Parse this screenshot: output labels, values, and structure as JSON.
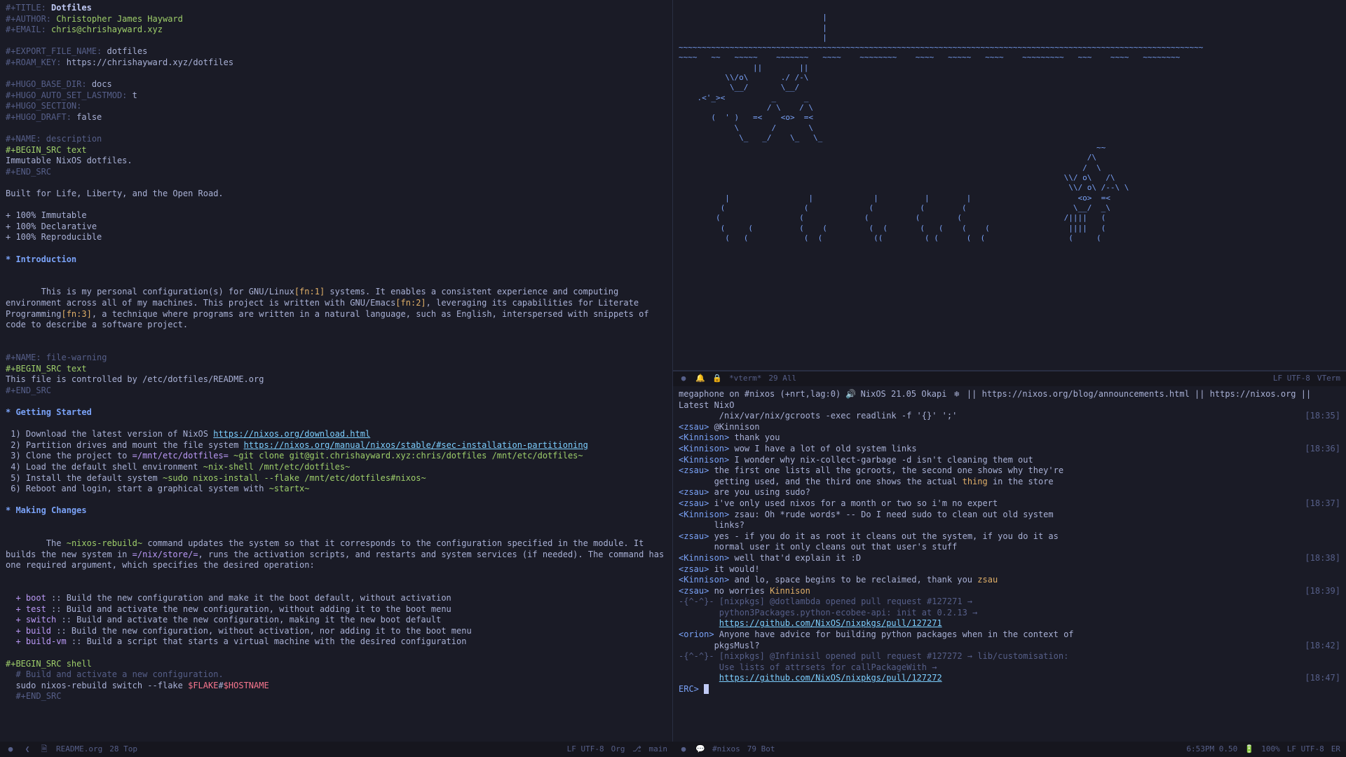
{
  "left": {
    "title_key": "#+TITLE:",
    "title": "Dotfiles",
    "author_key": "#+AUTHOR:",
    "author": "Christopher James Hayward",
    "email_key": "#+EMAIL:",
    "email": "chris@chrishayward.xyz",
    "export_key": "#+EXPORT_FILE_NAME:",
    "export": "dotfiles",
    "roam_key_key": "#+ROAM_KEY:",
    "roam_key": "https://chrishayward.xyz/dotfiles",
    "hugo_base_key": "#+HUGO_BASE_DIR:",
    "hugo_base": "docs",
    "hugo_lastmod_key": "#+HUGO_AUTO_SET_LASTMOD:",
    "hugo_lastmod": "t",
    "hugo_section_key": "#+HUGO_SECTION:",
    "hugo_draft_key": "#+HUGO_DRAFT:",
    "hugo_draft": "false",
    "name_desc": "#+NAME: description",
    "begin_text": "#+BEGIN_SRC text",
    "desc_body": "Immutable NixOS dotfiles.",
    "end_src": "#+END_SRC",
    "tagline": "Built for Life, Liberty, and the Open Road.",
    "bul1": "+ 100% Immutable",
    "bul2": "+ 100% Declarative",
    "bul3": "+ 100% Reproducible",
    "h_intro": "* Introduction",
    "intro_1a": "This is my personal configuration(s) for GNU/Linux",
    "intro_fn1": "[fn:1]",
    "intro_1b": " systems. It enables a consistent experience and computing environment across all of my machines. This project is written with GNU/Emacs",
    "intro_fn2": "[fn:2]",
    "intro_1c": ", leveraging its capabilities for Literate Programming",
    "intro_fn3": "[fn:3]",
    "intro_1d": ", a technique where programs are written in a natural language, such as English, interspersed with snippets of code to describe a software project.",
    "name_warn": "#+NAME: file-warning",
    "warn_body": "This file is controlled by /etc/dotfiles/README.org",
    "h_getting": "* Getting Started",
    "gs1a": "1) Download the latest version of NixOS ",
    "gs1link": "https://nixos.org/download.html",
    "gs2a": "2) Partition drives and mount the file system ",
    "gs2link": "https://nixos.org/manual/nixos/stable/#sec-installation-partitioning",
    "gs3a": "3) Clone the project to ",
    "gs3path": "=/mnt/etc/dotfiles=",
    "gs3cmd": " ~git clone git@git.chrishayward.xyz:chris/dotfiles /mnt/etc/dotfiles~",
    "gs4a": "4) Load the default shell environment ",
    "gs4cmd": "~nix-shell /mnt/etc/dotfiles~",
    "gs5a": "5) Install the default system ",
    "gs5cmd": "~sudo nixos-install --flake /mnt/etc/dotfiles#nixos~",
    "gs6a": "6) Reboot and login, start a graphical system with ",
    "gs6cmd": "~startx~",
    "h_changes": "* Making Changes",
    "mc1a": "The ",
    "mc1cmd": "~nixos-rebuild~",
    "mc1b": " command updates the system so that it corresponds to the configuration specified in the module. It builds the new system in ",
    "mc1path": "=/nix/store/=",
    "mc1c": ", runs the activation scripts, and restarts and system services (if needed). The command has one required argument, which specifies the desired operation:",
    "mc_boot": "+ boot :: Build the new configuration and make it the boot default, without activation",
    "mc_test": "+ test :: Build and activate the new configuration, without adding it to the boot menu",
    "mc_switch": "+ switch :: Build and activate the new configuration, making it the new boot default",
    "mc_build": "+ build :: Build the new configuration, without activation, nor adding it to the boot menu",
    "mc_buildvm": "+ build-vm :: Build a script that starts a virtual machine with the desired configuration",
    "begin_shell": "#+BEGIN_SRC shell",
    "sh_comment": "# Build and activate a new configuration.",
    "sh_cmd_a": "sudo nixos-rebuild switch --flake ",
    "sh_var1": "$FLAKE",
    "sh_hash": "#",
    "sh_var2": "$HOSTNAME",
    "modeline": {
      "file": "README.org",
      "pos": "28 Top",
      "enc": "LF UTF-8",
      "mode": "Org",
      "branch_icon": "⎇",
      "branch": "main"
    }
  },
  "vterm": {
    "ascii": "                               |\n                               |\n                               |\n~~~~~~~~~~~~~~~~~~~~~~~~~~~~~~~~~~~~~~~~~~~~~~~~~~~~~~~~~~~~~~~~~~~~~~~~~~~~~~~~~~~~~~~~~~~~~~~~~~~~~~~~~~~~~~~~~\n~~~~   ~~   ~~~~~    ~~~~~~~   ~~~~    ~~~~~~~~    ~~~~   ~~~~~   ~~~~    ~~~~~~~~~   ~~~    ~~~~   ~~~~~~~~\n                ||        ||\n          \\\\/o\\       ./ /-\\\n           \\__/       \\__/\n    .<'_><          _      _\n                   / \\    / \\\n       (  ' )   =<    <o>  =<\n            \\       /       \\\n             \\_   _/    \\_   \\_\n                                                                                          ~~\n                                                                                        /\\\n                                                                                       /  \\\n                                                                                   \\\\/ o\\   /\\\n                                                                                    \\\\/ o\\ /--\\ \\\n          |                 |             |          |        |                       <o>  =<\n         (                 (             (          (        (                       \\__/  _\\\n        (                 (             (          (        (                      /||||   (\n         (     (          (    (         (  (       (   (    (    (                 ||||   (\n          (   (            (  (           ((         ( (      (  (                  (     (",
    "modeline": {
      "name": "*vterm*",
      "pos": "29 All",
      "enc": "LF UTF-8",
      "mode": "VTerm"
    }
  },
  "irc": {
    "topic_a": "megaphone on #nixos (+nrt,lag:0) ",
    "topic_b": " NixOS 21.05 Okapi ",
    "topic_c": " || https://nixos.org/blog/announcements.html || https://nixos.org || Latest NixO",
    "topic2": "        /nix/var/nix/gcroots -exec readlink -f '{}' ';'",
    "t1": "[18:35]",
    "t2": "[18:36]",
    "t3": "[18:37]",
    "t4": "[18:38]",
    "t5": "[18:39]",
    "t6": "[18:42]",
    "t7": "[18:47]",
    "l": [
      {
        "n": "<zsau>",
        "t": " @Kinnison"
      },
      {
        "n": "<Kinnison>",
        "t": " thank you"
      },
      {
        "n": "<Kinnison>",
        "t": " wow I have a lot of old system links"
      },
      {
        "n": "<Kinnison>",
        "t": " I wonder why nix-collect-garbage -d isn't cleaning them out"
      },
      {
        "n": "<zsau>",
        "t": " the first one lists all the gcroots, the second one shows why they're"
      },
      {
        "n": "",
        "t": "       getting used, and the third one shows the actual "
      },
      {
        "hl": "thing",
        "t2": " in the store"
      },
      {
        "n": "<zsau>",
        "t": " are you using sudo?"
      },
      {
        "n": "<zsau>",
        "t": " i've only used nixos for a month or two so i'm no expert"
      },
      {
        "n": "<Kinnison>",
        "t": " zsau: Oh *rude words* -- Do I need sudo to clean out old system"
      },
      {
        "n": "",
        "t": "       links?"
      },
      {
        "n": "<zsau>",
        "t": " yes - if you do it as root it cleans out the system, if you do it as"
      },
      {
        "n": "",
        "t": "       normal user it only cleans out that user's stuff"
      },
      {
        "n": "<Kinnison>",
        "t": " well that'd explain it :D"
      },
      {
        "n": "<zsau>",
        "t": " it would!"
      },
      {
        "n": "<Kinnison>",
        "t": " and lo, space begins to be reclaimed, thank you "
      },
      {
        "hl": "zsau"
      },
      {
        "n": "<zsau>",
        "t": " no worries "
      },
      {
        "hl": "Kinnison"
      }
    ],
    "bot1a": "-{^-^}- [nixpkgs] @dotlambda opened pull request #127271 →",
    "bot1b": "        python3Packages.python-ecobee-api: init at 0.2.13 →",
    "bot1link": "https://github.com/NixOS/nixpkgs/pull/127271",
    "orion_n": "<orion>",
    "orion_t": " Anyone have advice for building python packages when in the context of",
    "orion_t2": "       pkgsMusl?",
    "bot2a": "-{^-^}- [nixpkgs] @Infinisil opened pull request #127272 → lib/customisation:",
    "bot2b": "        Use lists of attrsets for callPackageWith →",
    "bot2link": "https://github.com/NixOS/nixpkgs/pull/127272",
    "prompt": "ERC>",
    "modeline": {
      "name": "#nixos",
      "pos": "79 Bot",
      "time": "6:53PM 0.50",
      "bat": "100%",
      "enc": "LF UTF-8",
      "mode": "ER"
    }
  }
}
